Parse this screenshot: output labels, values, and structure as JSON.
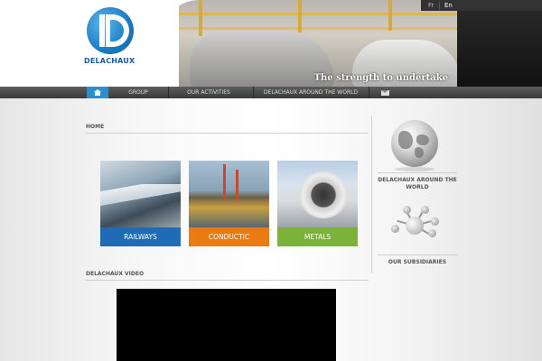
{
  "brand": {
    "logo_text": "DELACHAUX",
    "slogan": "The strength to undertake"
  },
  "languages": [
    {
      "code": "Fr",
      "active": false
    },
    {
      "code": "En",
      "active": true
    }
  ],
  "nav": {
    "home_icon": "home-icon",
    "items": [
      "GROUP",
      "OUR ACTIVITIES",
      "DELACHAUX AROUND THE WORLD"
    ],
    "mail_icon": "mail-icon"
  },
  "breadcrumb": "HOME",
  "tiles": [
    {
      "label": "RAILWAYS",
      "color": "#1f6bb6"
    },
    {
      "label": "CONDUCTIC",
      "color": "#ea7a12"
    },
    {
      "label": "METALS",
      "color": "#7ab23a"
    }
  ],
  "video_title": "DELACHAUX VIDEO",
  "sidebar": {
    "world_label": "DELACHAUX AROUND THE WORLD",
    "world_icon": "globe-icon",
    "subsidiaries_label": "OUR SUBSIDIARIES",
    "subsidiaries_icon": "network-icon"
  },
  "colors": {
    "accent": "#2a8fd1",
    "nav_bg": "#4a4a4a"
  }
}
